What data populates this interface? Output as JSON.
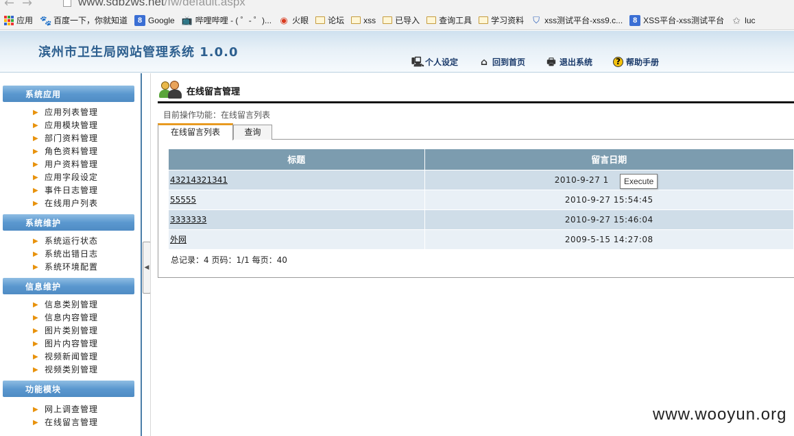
{
  "browser": {
    "url_host": "www.sdbzws.net",
    "url_path": "/fw/default.aspx",
    "bookmarks": [
      {
        "label": "应用",
        "icon": "apps-grid-icon"
      },
      {
        "label": "百度一下，你就知道",
        "icon": "baidu-paw-icon"
      },
      {
        "label": "Google",
        "icon": "google-icon"
      },
      {
        "label": "哔哩哔哩 - ( ゜- ゜)...",
        "icon": "bilibili-tv-icon"
      },
      {
        "label": "火眼",
        "icon": "fireeye-icon"
      },
      {
        "label": "论坛",
        "icon": "folder-icon"
      },
      {
        "label": "xss",
        "icon": "folder-icon"
      },
      {
        "label": "已导入",
        "icon": "folder-icon"
      },
      {
        "label": "查询工具",
        "icon": "folder-icon"
      },
      {
        "label": "学习资料",
        "icon": "folder-icon"
      },
      {
        "label": "xss测试平台-xss9.c...",
        "icon": "shield-icon"
      },
      {
        "label": "XSS平台-xss测试平台",
        "icon": "google-icon"
      },
      {
        "label": "luc",
        "icon": "star-icon"
      }
    ]
  },
  "app": {
    "title": "滨州市卫生局网站管理系统 1.0.0",
    "top_links": [
      {
        "label": "个人设定",
        "icon": "user-settings-icon"
      },
      {
        "label": "回到首页",
        "icon": "home-icon"
      },
      {
        "label": "退出系统",
        "icon": "logout-icon"
      },
      {
        "label": "帮助手册",
        "icon": "help-icon"
      }
    ]
  },
  "sidebar": {
    "groups": [
      {
        "title": "系统应用",
        "items": [
          "应用列表管理",
          "应用模块管理",
          "部门资料管理",
          "角色资料管理",
          "用户资料管理",
          "应用字段设定",
          "事件日志管理",
          "在线用户列表"
        ]
      },
      {
        "title": "系统维护",
        "items": [
          "系统运行状态",
          "系统出错日志",
          "系统环境配置"
        ]
      },
      {
        "title": "信息维护",
        "items": [
          "信息类别管理",
          "信息内容管理",
          "图片类别管理",
          "图片内容管理",
          "视频新闻管理",
          "视频类别管理"
        ]
      },
      {
        "title": "功能模块",
        "items": [
          "网上调查管理",
          "在线留言管理"
        ]
      }
    ]
  },
  "main": {
    "page_title": "在线留言管理",
    "crumb": "目前操作功能：在线留言列表",
    "tabs": [
      "在线留言列表",
      "查询"
    ],
    "table": {
      "headers": [
        "标题",
        "留言日期"
      ],
      "rows": [
        {
          "title": "43214321341",
          "date": "2010-9-27 1"
        },
        {
          "title": "55555",
          "date": "2010-9-27 15:54:45"
        },
        {
          "title": "3333333",
          "date": "2010-9-27 15:46:04"
        },
        {
          "title": "外网",
          "date": "2009-5-15 14:27:08"
        }
      ]
    },
    "pager": "总记录：4 页码：1/1 每页：40"
  },
  "tooltip": "Execute",
  "watermark": "www.wooyun.org"
}
